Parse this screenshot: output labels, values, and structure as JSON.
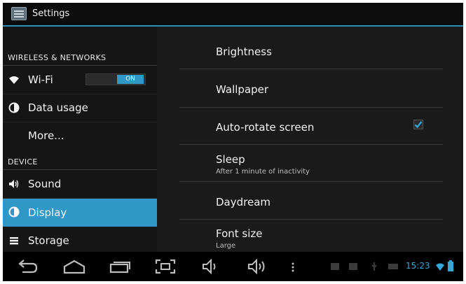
{
  "window": {
    "title": "Settings"
  },
  "sidebar": {
    "sections": [
      {
        "header": "WIRELESS & NETWORKS"
      },
      {
        "header": "DEVICE"
      }
    ],
    "items": [
      {
        "label": "Wi-Fi",
        "icon": "wifi-icon",
        "toggle": "ON"
      },
      {
        "label": "Data usage",
        "icon": "data-usage-icon"
      },
      {
        "label": "More..."
      },
      {
        "label": "Sound",
        "icon": "speaker-icon"
      },
      {
        "label": "Display",
        "icon": "display-icon",
        "selected": true
      },
      {
        "label": "Storage",
        "icon": "storage-icon"
      }
    ]
  },
  "display_settings": [
    {
      "title": "Brightness"
    },
    {
      "title": "Wallpaper"
    },
    {
      "title": "Auto-rotate screen",
      "checked": true
    },
    {
      "title": "Sleep",
      "summary": "After 1 minute of inactivity"
    },
    {
      "title": "Daydream"
    },
    {
      "title": "Font size",
      "summary": "Large"
    }
  ],
  "status_bar": {
    "time": "15:23"
  },
  "colors": {
    "accent": "#2f98c7",
    "background": "#151515",
    "clock": "#34a7d8"
  }
}
